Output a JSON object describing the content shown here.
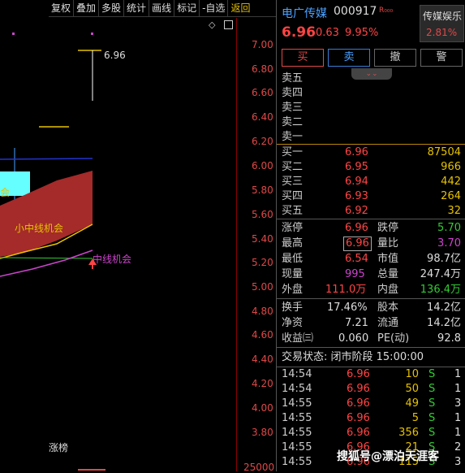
{
  "toolbar": {
    "items": [
      "复权",
      "叠加",
      "多股",
      "统计",
      "画线",
      "标记",
      "-自选"
    ],
    "back": "返回"
  },
  "chart": {
    "price_ticks": [
      "7.00",
      "6.80",
      "6.60",
      "6.40",
      "6.20",
      "6.00",
      "5.80",
      "5.60",
      "5.40",
      "5.20",
      "5.00",
      "4.80",
      "4.60",
      "4.40",
      "4.20",
      "4.00",
      "3.80"
    ],
    "high_marker": "6.96",
    "label_small_mid": "小中线机会",
    "label_mid": "中线机会",
    "label_left": "会",
    "label_bottom": "涨榜",
    "volume_tick": "25000"
  },
  "quote": {
    "name": "电广传媒",
    "code": "000917",
    "tag": "R₀₀₀",
    "sector_name": "传媒娱乐",
    "sector_pct": "2.81%",
    "price": "6.96",
    "change": "0.63",
    "change_pct": "9.95%",
    "buttons": {
      "buy": "买",
      "sell": "卖",
      "cancel": "撤",
      "alert": "警"
    },
    "expand": "⌄⌄",
    "asks": [
      "卖五",
      "卖四",
      "卖三",
      "卖二",
      "卖一"
    ],
    "bids": [
      {
        "label": "买一",
        "price": "6.96",
        "vol": "87504"
      },
      {
        "label": "买二",
        "price": "6.95",
        "vol": "966"
      },
      {
        "label": "买三",
        "price": "6.94",
        "vol": "442"
      },
      {
        "label": "买四",
        "price": "6.93",
        "vol": "264"
      },
      {
        "label": "买五",
        "price": "6.92",
        "vol": "32"
      }
    ],
    "stats": {
      "limit_up_l": "涨停",
      "limit_up": "6.96",
      "limit_down_l": "跌停",
      "limit_down": "5.70",
      "high_l": "最高",
      "high": "6.96",
      "vol_ratio_l": "量比",
      "vol_ratio": "3.70",
      "low_l": "最低",
      "low": "6.54",
      "mkt_cap_l": "市值",
      "mkt_cap": "98.7亿",
      "current_l": "现量",
      "current": "995",
      "total_l": "总量",
      "total": "247.4万",
      "outer_l": "外盘",
      "outer": "111.0万",
      "inner_l": "内盘",
      "inner": "136.4万",
      "turnover_l": "换手",
      "turnover": "17.46%",
      "shares_l": "股本",
      "shares": "14.2亿",
      "nav_l": "净资",
      "nav": "7.21",
      "float_l": "流通",
      "float": "14.2亿",
      "eps_l": "收益㈢",
      "eps": "0.060",
      "pe_l": "PE(动)",
      "pe": "92.8"
    },
    "status": "交易状态: 闭市阶段 15:00:00",
    "ticks": [
      {
        "time": "14:54",
        "price": "6.96",
        "vol": "10",
        "side": "S",
        "n": "1"
      },
      {
        "time": "14:54",
        "price": "6.96",
        "vol": "50",
        "side": "S",
        "n": "1"
      },
      {
        "time": "14:55",
        "price": "6.96",
        "vol": "49",
        "side": "S",
        "n": "3"
      },
      {
        "time": "14:55",
        "price": "6.96",
        "vol": "5",
        "side": "S",
        "n": "1"
      },
      {
        "time": "14:55",
        "price": "6.96",
        "vol": "356",
        "side": "S",
        "n": "1"
      },
      {
        "time": "14:55",
        "price": "6.96",
        "vol": "21",
        "side": "S",
        "n": "2"
      },
      {
        "time": "14:55",
        "price": "6.96",
        "vol": "115",
        "side": "S",
        "n": "3"
      }
    ]
  },
  "watermark": "搜狐号@漂泊天涯客"
}
